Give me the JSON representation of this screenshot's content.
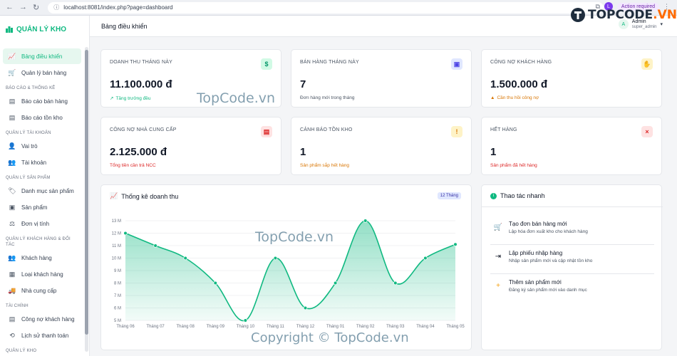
{
  "browser": {
    "url": "localhost:8081/index.php?page=dashboard",
    "action_label": "Action required",
    "profile_initial": "L"
  },
  "sidebar": {
    "brand": "QUẢN LÝ KHO",
    "items": [
      {
        "label": "Bảng điều khiển",
        "icon": "chart-line-icon",
        "active": true
      },
      {
        "label": "Quản lý bán hàng",
        "icon": "cart-icon"
      },
      {
        "section": "BÁO CÁO & THỐNG KÊ"
      },
      {
        "label": "Báo cáo bán hàng",
        "icon": "report-icon"
      },
      {
        "label": "Báo cáo tồn kho",
        "icon": "report-icon"
      },
      {
        "section": "QUẢN LÝ TÀI KHOẢN"
      },
      {
        "label": "Vai trò",
        "icon": "user-shield-icon"
      },
      {
        "label": "Tài khoản",
        "icon": "users-icon"
      },
      {
        "section": "QUẢN LÝ SẢN PHẨM"
      },
      {
        "label": "Danh mục sản phẩm",
        "icon": "tag-icon"
      },
      {
        "label": "Sản phẩm",
        "icon": "box-icon"
      },
      {
        "label": "Đơn vị tính",
        "icon": "scale-icon"
      },
      {
        "section": "QUẢN LÝ KHÁCH HÀNG & ĐỐI TÁC"
      },
      {
        "label": "Khách hàng",
        "icon": "users-icon"
      },
      {
        "label": "Loại khách hàng",
        "icon": "id-card-icon"
      },
      {
        "label": "Nhà cung cấp",
        "icon": "truck-icon"
      },
      {
        "section": "TÀI CHÍNH"
      },
      {
        "label": "Công nợ khách hàng",
        "icon": "invoice-icon"
      },
      {
        "label": "Lịch sử thanh toán",
        "icon": "history-icon"
      },
      {
        "section": "QUẢN LÝ KHO"
      }
    ]
  },
  "header": {
    "title": "Bảng điều khiển",
    "user_initial": "A",
    "user_name": "Admin",
    "user_role": "super_admin"
  },
  "stats": [
    {
      "label": "DOANH THU THÁNG NÀY",
      "value": "11.100.000 đ",
      "sub": "Tăng trưởng đều",
      "sub_icon": "↗",
      "sub_color": "#10b981",
      "icon": "$",
      "icon_bg": "#d1fae5",
      "icon_color": "#059669"
    },
    {
      "label": "BÁN HÀNG THÁNG NÀY",
      "value": "7",
      "sub": "Đơn hàng mới trong tháng",
      "sub_icon": "",
      "sub_color": "#4b5563",
      "icon": "▣",
      "icon_bg": "#e0e7ff",
      "icon_color": "#4f46e5"
    },
    {
      "label": "CÔNG NỢ KHÁCH HÀNG",
      "value": "1.500.000 đ",
      "sub": "Cần thu hồi công nợ",
      "sub_icon": "▲",
      "sub_color": "#d97706",
      "icon": "✋",
      "icon_bg": "#fef3c7",
      "icon_color": "#d97706"
    },
    {
      "label": "CÔNG NỢ NHÀ CUNG CẤP",
      "value": "2.125.000 đ",
      "sub": "Tổng tiền cần trả NCC",
      "sub_icon": "",
      "sub_color": "#dc2626",
      "icon": "▤",
      "icon_bg": "#fee2e2",
      "icon_color": "#dc2626"
    },
    {
      "label": "CẢNH BÁO TỒN KHO",
      "value": "1",
      "sub": "Sản phẩm sắp hết hàng",
      "sub_icon": "",
      "sub_color": "#d97706",
      "icon": "!",
      "icon_bg": "#fef3c7",
      "icon_color": "#d97706"
    },
    {
      "label": "HẾT HÀNG",
      "value": "1",
      "sub": "Sản phẩm đã hết hàng",
      "sub_icon": "",
      "sub_color": "#dc2626",
      "icon": "×",
      "icon_bg": "#fee2e2",
      "icon_color": "#dc2626"
    }
  ],
  "revenue_panel": {
    "title": "Thống kê doanh thu",
    "badge": "12 Tháng"
  },
  "chart_data": {
    "type": "area",
    "title": "Thống kê doanh thu",
    "categories": [
      "Tháng 06",
      "Tháng 07",
      "Tháng 08",
      "Tháng 09",
      "Tháng 10",
      "Tháng 11",
      "Tháng 12",
      "Tháng 01",
      "Tháng 02",
      "Tháng 03",
      "Tháng 04",
      "Tháng 05"
    ],
    "values": [
      12,
      11,
      10,
      8,
      5,
      10,
      6,
      8,
      13,
      8,
      10,
      11.1
    ],
    "ylim": [
      5,
      13
    ],
    "yticks": [
      "5 M",
      "6 M",
      "7 M",
      "8 M",
      "9 M",
      "10 M",
      "11 M",
      "12 M",
      "13 M"
    ],
    "color": "#10b981",
    "grid": true
  },
  "quick_actions": {
    "title": "Thao tác nhanh",
    "items": [
      {
        "title": "Tạo đơn bán hàng mới",
        "desc": "Lập hóa đơn xuất kho cho khách hàng",
        "icon": "cart-plus-icon",
        "glyph": "🛒",
        "color": "#10b981"
      },
      {
        "title": "Lập phiếu nhập hàng",
        "desc": "Nhập sản phẩm mới và cập nhật tồn kho",
        "icon": "file-import-icon",
        "glyph": "⇥",
        "color": "#111827"
      },
      {
        "title": "Thêm sản phẩm mới",
        "desc": "Đăng ký sản phẩm mới vào danh mục",
        "icon": "plus-icon",
        "glyph": "+",
        "color": "#f59e0b"
      }
    ]
  },
  "watermarks": {
    "mid1": "TopCode.vn",
    "mid2": "TopCode.vn",
    "copyright": "Copyright © TopCode.vn",
    "logo_main": "TOPCODE",
    "logo_dot": ".VN"
  }
}
